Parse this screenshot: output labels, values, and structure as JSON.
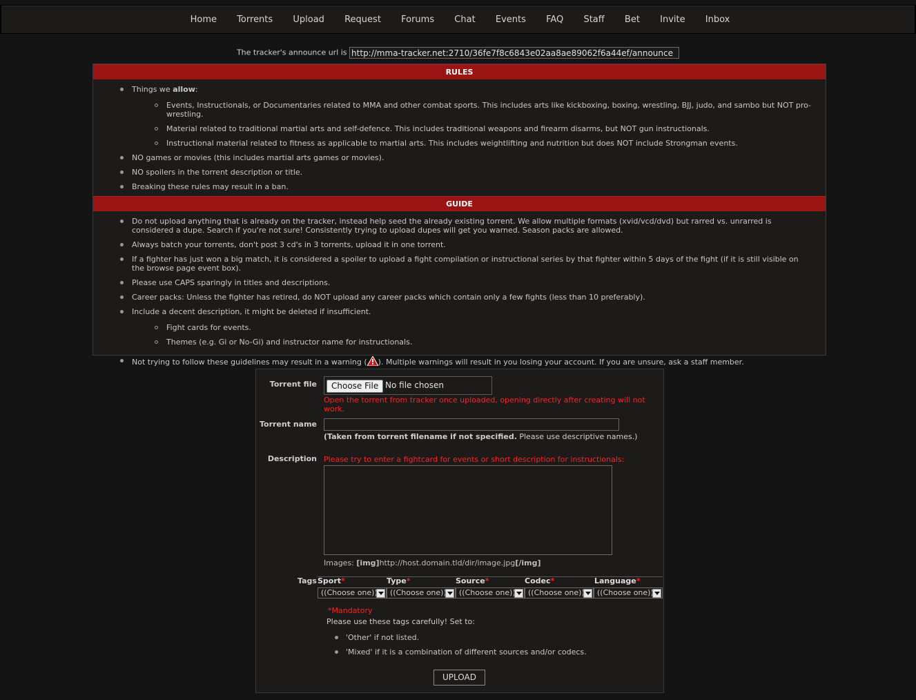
{
  "nav": {
    "items": [
      {
        "label": "Home"
      },
      {
        "label": "Torrents"
      },
      {
        "label": "Upload"
      },
      {
        "label": "Request"
      },
      {
        "label": "Forums"
      },
      {
        "label": "Chat"
      },
      {
        "label": "Events"
      },
      {
        "label": "FAQ"
      },
      {
        "label": "Staff"
      },
      {
        "label": "Bet"
      },
      {
        "label": "Invite"
      },
      {
        "label": "Inbox"
      }
    ]
  },
  "announce": {
    "label": "The tracker's announce url is",
    "url": "http://mma-tracker.net:2710/36fe7f8c6843e02aa8ae89062f6a44ef/announce"
  },
  "rules": {
    "heading": "RULES",
    "allow_prefix": "Things we ",
    "allow_bold": "allow",
    "allow_suffix": ":",
    "allow_items": [
      "Events, Instructionals, or Documentaries related to MMA and other combat sports. This includes arts like kickboxing, boxing, wrestling, BJJ, judo, and sambo but NOT pro-wrestling.",
      "Material related to traditional martial arts and self-defence. This includes traditional weapons and firearm disarms, but NOT gun instructionals.",
      "Instructional material related to fitness as applicable to martial arts. This includes weightlifting and nutrition but does NOT include Strongman events."
    ],
    "items": [
      "NO games or movies (this includes martial arts games or movies).",
      "NO spoilers in the torrent description or title.",
      "Breaking these rules may result in a ban."
    ]
  },
  "guide": {
    "heading": "GUIDE",
    "items": [
      "Do not upload anything that is already on the tracker, instead help seed the already existing torrent. We allow multiple formats (xvid/vcd/dvd) but rarred vs. unrarred is considered a dupe. Search if you're not sure! Consistently trying to upload dupes will get you warned. Season packs are allowed.",
      "Always batch your torrents, don't post 3 cd's in 3 torrents, upload it in one torrent.",
      "If a fighter has just won a big match, it is considered a spoiler to upload a fight compilation or instructional series by that fighter within 5 days of the fight (if it is still visible on the browse page event box).",
      "Please use CAPS sparingly in titles and descriptions.",
      "Career packs: Unless the fighter has retired, do NOT upload any career packs which contain only a few fights (less than 10 preferably).",
      "Include a decent description, it might be deleted if insufficient."
    ],
    "description_sub": [
      "Fight cards for events.",
      "Themes (e.g. Gi or No-Gi) and instructor name for instructionals."
    ],
    "warning_prefix": "Not trying to follow these guidelines may result in a warning (",
    "warning_suffix": "). Multiple warnings will result in you losing your account. If you are unsure, ask a staff member."
  },
  "form": {
    "torrent_file_label": "Torrent file",
    "choose_file_label": "Choose File",
    "no_file_text": "No file chosen",
    "file_note": "Open the torrent from tracker once uploaded, opening directly after creating will not work.",
    "torrent_name_label": "Torrent name",
    "name_note_bold": "(Taken from torrent filename if not specified.",
    "name_note_rest": " Please use descriptive names.)",
    "torrent_name_value": "",
    "description_label": "Description",
    "description_note": "Please try to enter a fightcard for events or short description for instructionals:",
    "description_value": "",
    "images_prefix": "Images: ",
    "images_open": "[img]",
    "images_url": "http://host.domain.tld/dir/image.jpg",
    "images_close": "[/img]",
    "tags_label": "Tags",
    "tags": [
      {
        "name": "Sport",
        "selected": "((Choose one))"
      },
      {
        "name": "Type",
        "selected": "((Choose one))"
      },
      {
        "name": "Source",
        "selected": "((Choose one))"
      },
      {
        "name": "Codec",
        "selected": "((Choose one))"
      },
      {
        "name": "Language",
        "selected": "((Choose one))"
      }
    ],
    "asterisk": "*",
    "mandatory_text": "Mandatory",
    "tags_help": "Please use these tags carefully! Set to:",
    "tags_help_items": [
      "'Other' if not listed.",
      "'Mixed' if it is a combination of different sources and/or codecs."
    ],
    "upload_label": "UPLOAD"
  },
  "colors": {
    "accent": "#9b1414",
    "background": "#141414",
    "panel": "#1c1b1a",
    "warning": "#ff2020"
  }
}
